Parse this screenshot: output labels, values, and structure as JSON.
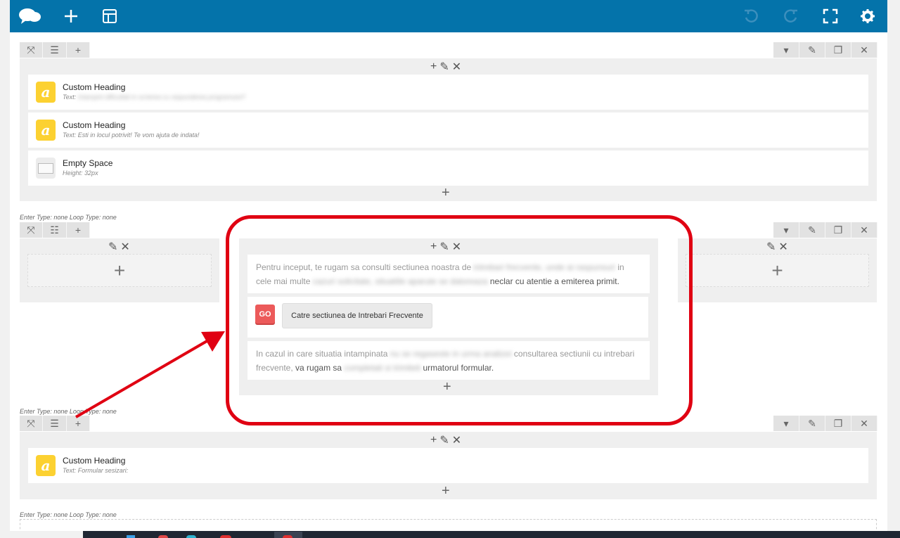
{
  "toolbar": {
    "icons": [
      "logo-icon",
      "add-icon",
      "layout-icon",
      "undo-icon",
      "redo-icon",
      "fullscreen-icon",
      "settings-icon"
    ]
  },
  "row1": {
    "elements": [
      {
        "title": "Custom Heading",
        "sub_label": "Text:",
        "sub_text": "Intampini dificultati in scrierea cu raspunderea programului?"
      },
      {
        "title": "Custom Heading",
        "sub_label": "Text:",
        "sub_text": "Esti in locul potrivit! Te vom ajuta de indata!"
      },
      {
        "title": "Empty Space",
        "sub_label": "Height:",
        "sub_text": "32px"
      }
    ]
  },
  "row2": {
    "meta": "Enter Type: none  Loop Type: none",
    "text1_visible": "Pentru inceput, te rugam sa consulti sectiunea noastra de",
    "text1_blur": "intrebari frecvente, unde ai raspunsuri",
    "text1_end": "in cele mai multe",
    "text1_line2_blur": "cazuri solicitate, situatiile aparute se datoreaza",
    "text1_line2_end": "neclar cu atentie a emiterea primit.",
    "go_label": "GO",
    "faq_button": "Catre sectiunea de Intrebari Frecvente",
    "text2_start": "In cazul in care situatia intampinata",
    "text2_blur": "nu se regaseste in urma analizei",
    "text2_end": "consultarea sectiunii cu intrebari frecvente,",
    "text2_line2_start": "va rugam sa",
    "text2_line2_blur": "completati si trimiteti",
    "text2_line2_end": "urmatorul formular."
  },
  "row3": {
    "meta": "Enter Type: none  Loop Type: none",
    "elements": [
      {
        "title": "Custom Heading",
        "sub_label": "Text:",
        "sub_text": "Formular sesizari:"
      }
    ]
  },
  "row4": {
    "meta": "Enter Type: none  Loop Type: none"
  },
  "colors": {
    "toolbar": "#0473aa",
    "highlight": "#e00012",
    "heading_icon": "#fcd131",
    "go_button": "#ec5a5a"
  }
}
